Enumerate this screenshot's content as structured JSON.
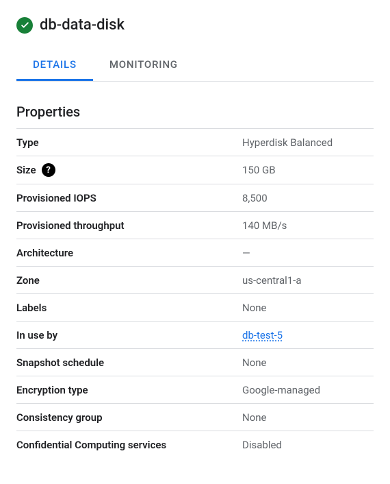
{
  "header": {
    "title": "db-data-disk"
  },
  "tabs": {
    "details": "DETAILS",
    "monitoring": "MONITORING"
  },
  "section": {
    "title": "Properties"
  },
  "properties": {
    "type": {
      "label": "Type",
      "value": "Hyperdisk Balanced"
    },
    "size": {
      "label": "Size",
      "value": "150 GB"
    },
    "iops": {
      "label": "Provisioned IOPS",
      "value": "8,500"
    },
    "throughput": {
      "label": "Provisioned throughput",
      "value": "140 MB/s"
    },
    "architecture": {
      "label": "Architecture",
      "value": "—"
    },
    "zone": {
      "label": "Zone",
      "value": "us-central1-a"
    },
    "labels": {
      "label": "Labels",
      "value": "None"
    },
    "inuseby": {
      "label": "In use by",
      "value": "db-test-5"
    },
    "snapshot": {
      "label": "Snapshot schedule",
      "value": "None"
    },
    "encryption": {
      "label": "Encryption type",
      "value": "Google-managed"
    },
    "consistency": {
      "label": "Consistency group",
      "value": "None"
    },
    "confidential": {
      "label": "Confidential Computing services",
      "value": "Disabled"
    }
  }
}
